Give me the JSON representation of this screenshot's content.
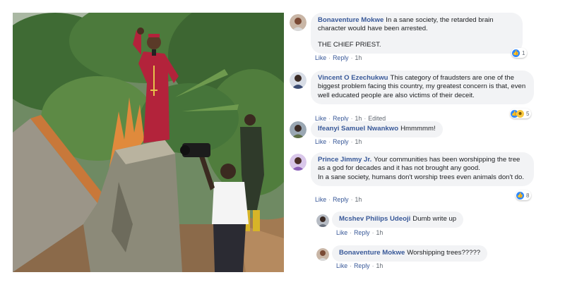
{
  "comments": [
    {
      "author": "Bonaventure Mokwe",
      "text": "In a sane society, the retarded brain character would have been arrested.",
      "extra": "THE CHIEF PRIEST.",
      "like_label": "Like",
      "reply_label": "Reply",
      "time": "1h",
      "reaction_count": "1"
    },
    {
      "author": "Vincent O Ezechukwu",
      "text": "This category of fraudsters are one of the biggest problem facing this country, my greatest concern is that, even well educated people are also victims of their deceit.",
      "like_label": "Like",
      "reply_label": "Reply",
      "time": "1h",
      "edited": "Edited",
      "reaction_count": "5"
    },
    {
      "author": "Ifeanyi Samuel Nwankwo",
      "text": "Hmmmmm!",
      "like_label": "Like",
      "reply_label": "Reply",
      "time": "1h"
    },
    {
      "author": "Prince Jimmy Jr.",
      "text": "Your communities has been worshipping the tree as a god for decades and it has not brought any good.",
      "extra": "In a sane society, humans don't worship trees even animals don't do.",
      "like_label": "Like",
      "reply_label": "Reply",
      "time": "1h",
      "reaction_count": "8"
    }
  ],
  "replies": [
    {
      "author": "Mcshev Philips Udeoji",
      "text": "Dumb write up",
      "like_label": "Like",
      "reply_label": "Reply",
      "time": "1h"
    },
    {
      "author": "Bonaventure Mokwe",
      "text": "Worshipping trees?????",
      "like_label": "Like",
      "reply_label": "Reply",
      "time": "1h"
    }
  ],
  "icons": {
    "like": "like-reaction-icon",
    "haha": "haha-reaction-icon"
  },
  "colors": {
    "author_link": "#385898",
    "bubble_bg": "#f2f3f5",
    "like_blue": "#2e89ff"
  }
}
